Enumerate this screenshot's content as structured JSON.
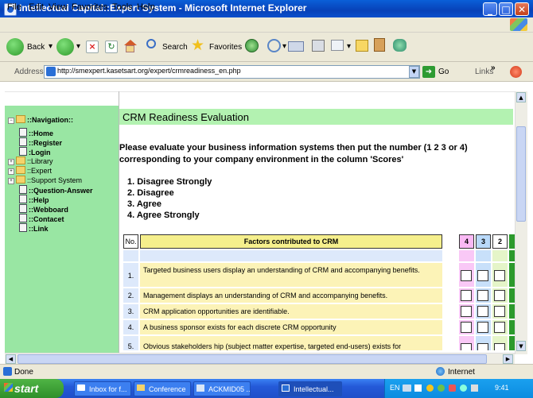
{
  "window": {
    "title": "Intellectual Capital::Expert System - Microsoft Internet Explorer",
    "minimize": "_",
    "maximize": "□",
    "close": "✕"
  },
  "menu": [
    "File",
    "Edit",
    "View",
    "Favorites",
    "Tools",
    "Help"
  ],
  "toolbar": {
    "back": "Back",
    "search": "Search",
    "favorites": "Favorites"
  },
  "address": {
    "label": "Address",
    "url": "http://smexpert.kasetsart.org/expert/crmreadiness_en.php",
    "go": "Go",
    "links": "Links"
  },
  "sidebar": {
    "header": "::Navigation::",
    "items": [
      {
        "label": "::Home",
        "type": "page"
      },
      {
        "label": "::Register",
        "type": "page"
      },
      {
        "label": ":Login",
        "type": "page"
      },
      {
        "label": "::Library",
        "type": "folder"
      },
      {
        "label": "::Expert",
        "type": "folder"
      },
      {
        "label": "::Support System",
        "type": "folder"
      },
      {
        "label": "::Question-Answer",
        "type": "page"
      },
      {
        "label": "::Help",
        "type": "page"
      },
      {
        "label": "::Webboard",
        "type": "page"
      },
      {
        "label": "::Contacet",
        "type": "page"
      },
      {
        "label": "::Link",
        "type": "page"
      }
    ]
  },
  "main": {
    "title": "CRM Readiness Evaluation",
    "instruction_line1": "Please evaluate your business information systems then put the number (1 2 3 or 4)",
    "instruction_line2": "corresponding to your company environment in the column 'Scores'",
    "scale": [
      "1. Disagree Strongly",
      "2. Disagree",
      "3. Agree",
      "4. Agree Strongly"
    ],
    "table": {
      "headers": {
        "no": "No.",
        "factors": "Factors contributed to CRM",
        "s4": "4",
        "s3": "3",
        "s2": "2"
      },
      "rows": [
        {
          "no": "1.",
          "text": "Targeted business users display an understanding of CRM and accompanying benefits."
        },
        {
          "no": "2.",
          "text": "Management displays an understanding of CRM and accompanying benefits."
        },
        {
          "no": "3.",
          "text": "CRM application opportunities are identifiable."
        },
        {
          "no": "4.",
          "text": "A business sponsor exists for each discrete CRM opportunity"
        },
        {
          "no": "5.",
          "text": "Obvious stakeholders hip (subject matter expertise, targeted end-users) exists for"
        }
      ]
    }
  },
  "status": {
    "left": "Done",
    "right": "Internet"
  },
  "taskbar": {
    "start": "start",
    "tasks": [
      "Inbox for f...",
      "Conference",
      "ACKMID05 ...",
      "Intellectual..."
    ],
    "lang": "EN",
    "clock": "9:41"
  },
  "colors": {
    "sidebar_bg": "#99e6a3",
    "title_bar_bg": "#b3f2b1",
    "table_header_bg": "#f5ef8c",
    "row_bg": "#fcf3b7"
  }
}
